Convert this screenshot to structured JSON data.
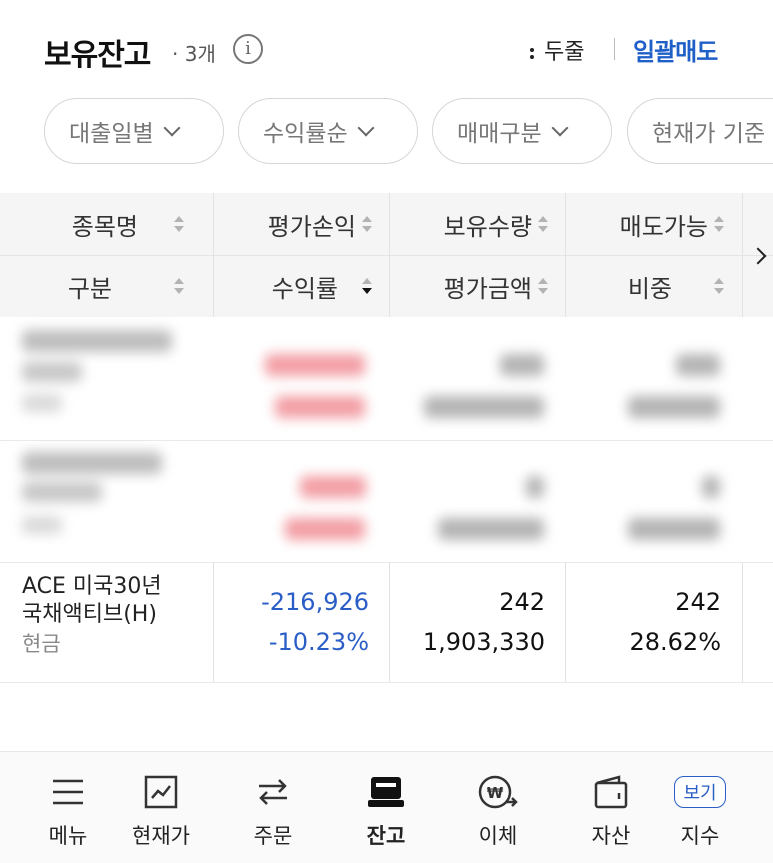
{
  "header": {
    "title": "보유잔고",
    "count": "· 3개",
    "two_line_label": "두줄",
    "sell_all_label": "일괄매도"
  },
  "filters": [
    {
      "label": "대출일별"
    },
    {
      "label": "수익률순"
    },
    {
      "label": "매매구분"
    },
    {
      "label": "현재가 기준"
    }
  ],
  "table": {
    "header_row1": [
      "종목명",
      "평가손익",
      "보유수량",
      "매도가능"
    ],
    "header_row2": [
      "구분",
      "수익률",
      "평가금액",
      "비중"
    ],
    "rows": [
      {
        "name_line1": "ACE 미국30년",
        "name_line2": "국채액티브(H)",
        "kind": "현금",
        "profit": "-216,926",
        "rate": "-10.23%",
        "quantity": "242",
        "eval_amount": "1,903,330",
        "sellable": "242",
        "weight": "28.62%"
      }
    ]
  },
  "bottom_nav": [
    {
      "label": "메뉴",
      "icon": "menu-icon"
    },
    {
      "label": "현재가",
      "icon": "chart-icon"
    },
    {
      "label": "주문",
      "icon": "swap-icon"
    },
    {
      "label": "잔고",
      "icon": "balance-icon",
      "active": true
    },
    {
      "label": "이체",
      "icon": "transfer-icon"
    },
    {
      "label": "자산",
      "icon": "wallet-icon"
    },
    {
      "label": "지수",
      "icon": "index-icon",
      "badge": "보기"
    }
  ],
  "colors": {
    "accent": "#1f5fc8",
    "negative": "#2a5ec6",
    "positive_blurred": "#e8505b"
  }
}
